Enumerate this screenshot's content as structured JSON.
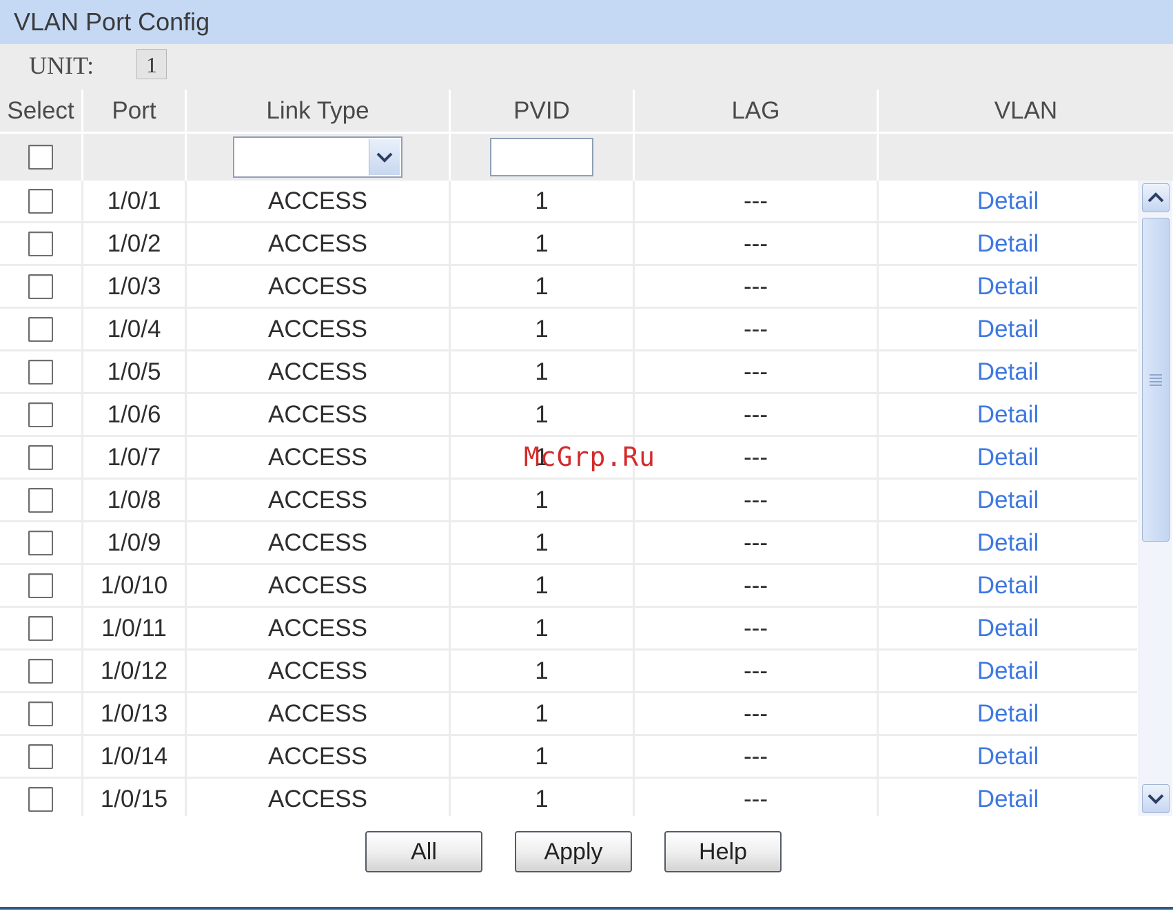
{
  "title": "VLAN Port Config",
  "unit": {
    "label": "UNIT:",
    "value": "1"
  },
  "columns": {
    "select": "Select",
    "port": "Port",
    "link_type": "Link Type",
    "pvid": "PVID",
    "lag": "LAG",
    "vlan": "VLAN"
  },
  "filter": {
    "link_type_value": "",
    "pvid_value": ""
  },
  "rows": [
    {
      "port": "1/0/1",
      "link_type": "ACCESS",
      "pvid": "1",
      "lag": "---",
      "vlan": "Detail"
    },
    {
      "port": "1/0/2",
      "link_type": "ACCESS",
      "pvid": "1",
      "lag": "---",
      "vlan": "Detail"
    },
    {
      "port": "1/0/3",
      "link_type": "ACCESS",
      "pvid": "1",
      "lag": "---",
      "vlan": "Detail"
    },
    {
      "port": "1/0/4",
      "link_type": "ACCESS",
      "pvid": "1",
      "lag": "---",
      "vlan": "Detail"
    },
    {
      "port": "1/0/5",
      "link_type": "ACCESS",
      "pvid": "1",
      "lag": "---",
      "vlan": "Detail"
    },
    {
      "port": "1/0/6",
      "link_type": "ACCESS",
      "pvid": "1",
      "lag": "---",
      "vlan": "Detail"
    },
    {
      "port": "1/0/7",
      "link_type": "ACCESS",
      "pvid": "1",
      "lag": "---",
      "vlan": "Detail"
    },
    {
      "port": "1/0/8",
      "link_type": "ACCESS",
      "pvid": "1",
      "lag": "---",
      "vlan": "Detail"
    },
    {
      "port": "1/0/9",
      "link_type": "ACCESS",
      "pvid": "1",
      "lag": "---",
      "vlan": "Detail"
    },
    {
      "port": "1/0/10",
      "link_type": "ACCESS",
      "pvid": "1",
      "lag": "---",
      "vlan": "Detail"
    },
    {
      "port": "1/0/11",
      "link_type": "ACCESS",
      "pvid": "1",
      "lag": "---",
      "vlan": "Detail"
    },
    {
      "port": "1/0/12",
      "link_type": "ACCESS",
      "pvid": "1",
      "lag": "---",
      "vlan": "Detail"
    },
    {
      "port": "1/0/13",
      "link_type": "ACCESS",
      "pvid": "1",
      "lag": "---",
      "vlan": "Detail"
    },
    {
      "port": "1/0/14",
      "link_type": "ACCESS",
      "pvid": "1",
      "lag": "---",
      "vlan": "Detail"
    },
    {
      "port": "1/0/15",
      "link_type": "ACCESS",
      "pvid": "1",
      "lag": "---",
      "vlan": "Detail"
    }
  ],
  "buttons": {
    "all": "All",
    "apply": "Apply",
    "help": "Help"
  },
  "watermark": "McGrp.Ru",
  "colors": {
    "title_bar": "#c5d9f5",
    "link": "#3e78e0",
    "header_bg": "#ececec",
    "bottom_rule": "#2f5b84",
    "watermark": "#d42a2a"
  },
  "icons": {
    "dropdown": "chevron-down-icon",
    "scroll_up": "chevron-up-icon",
    "scroll_down": "chevron-down-icon",
    "scroll_thumb": "grip-icon"
  }
}
